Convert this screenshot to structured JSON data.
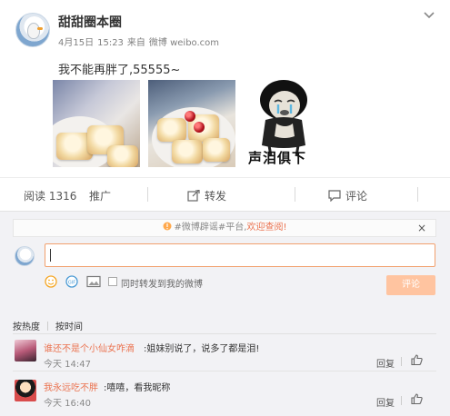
{
  "post": {
    "username": "甜甜圈本圈",
    "date": "4月15日",
    "time": "15:23",
    "source_prefix": "来自",
    "source": "微博 weibo.com",
    "text": "我不能再胖了,55555~",
    "meme_caption": "声泪俱下"
  },
  "actions": {
    "read_label": "阅读",
    "read_count": "1316",
    "promote_label": "推广",
    "repost_label": "转发",
    "comment_label": "评论"
  },
  "comments_panel": {
    "notice_prefix": "#微博辟谣#平台,",
    "notice_link": "欢迎查阅!",
    "close": "×",
    "input_value": "",
    "repost_checkbox_label": "同时转发到我的微博",
    "submit_label": "评论",
    "sort_hot": "按热度",
    "sort_time": "按时间"
  },
  "comments": [
    {
      "name": "谁还不是个小仙女咋滴",
      "text": ":姐妹别说了，说多了都是泪!",
      "time": "今天 14:47",
      "reply_label": "回复"
    },
    {
      "name": "我永远吃不胖",
      "text": ":嘻嘻，看我昵称",
      "time": "今天 16:40",
      "reply_label": "回复"
    }
  ],
  "colors": {
    "accent": "#eb7350",
    "submit_disabled": "#ffc4a0",
    "panel_bg": "#f2f2f5"
  }
}
